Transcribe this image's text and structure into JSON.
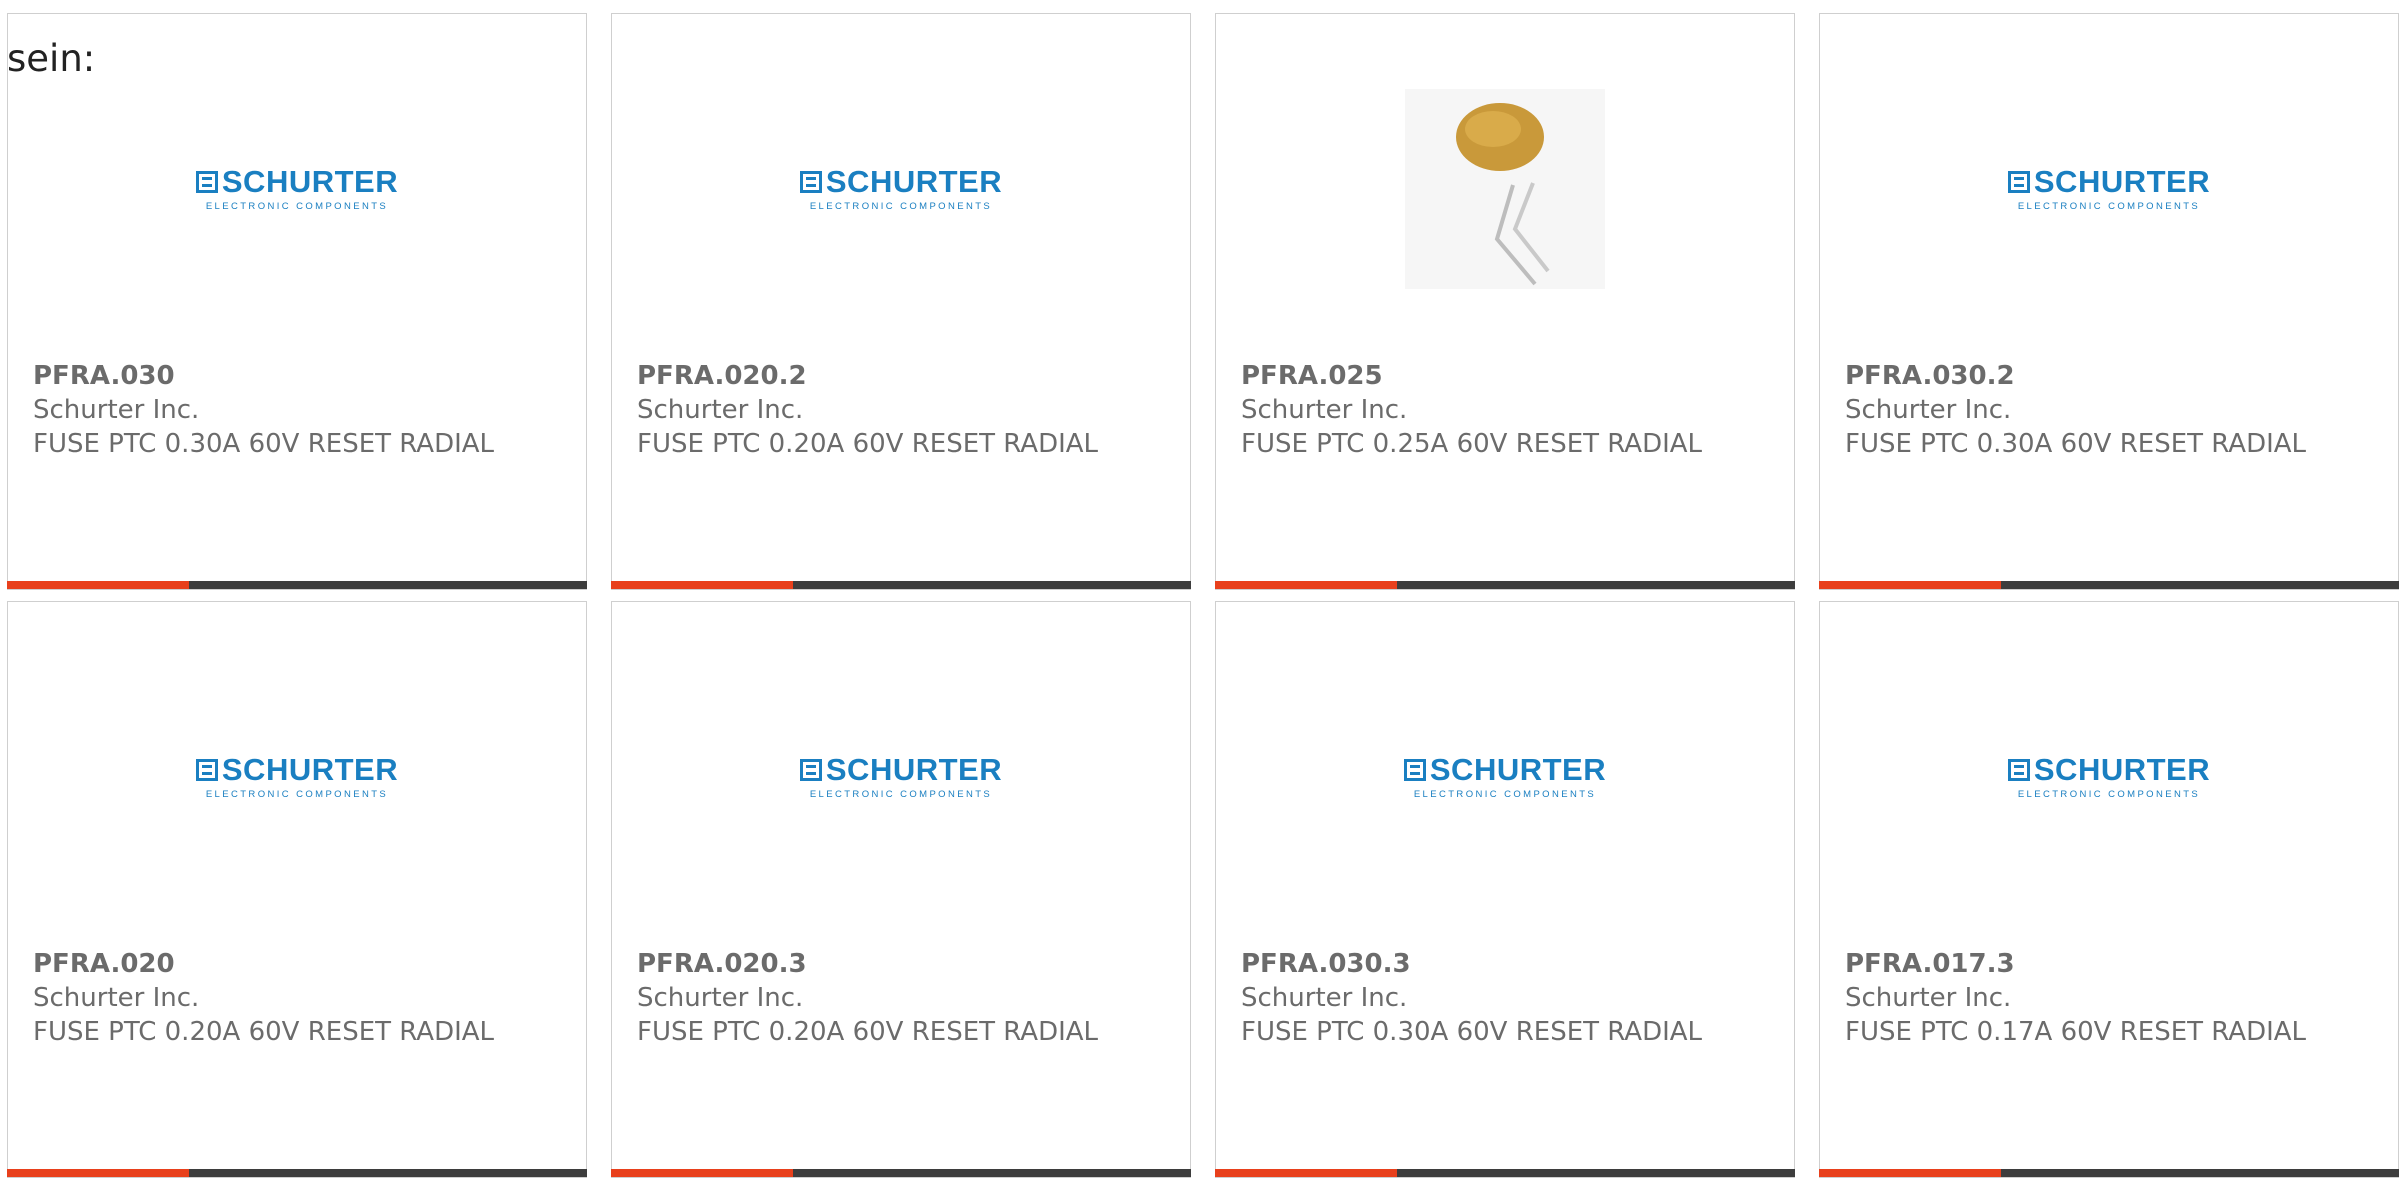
{
  "intro_text": "sein:",
  "colors": {
    "accent": "#e8401c",
    "bar": "#3d3d3d",
    "brand": "#1a7fc1",
    "text": "#6b6b6b"
  },
  "products": [
    {
      "part_number": "PFRA.030",
      "manufacturer": "Schurter Inc.",
      "description": "FUSE PTC 0.30A 60V RESET RADIAL",
      "image": "schurter-logo"
    },
    {
      "part_number": "PFRA.020.2",
      "manufacturer": "Schurter Inc.",
      "description": "FUSE PTC 0.20A 60V RESET RADIAL",
      "image": "schurter-logo"
    },
    {
      "part_number": "PFRA.025",
      "manufacturer": "Schurter Inc.",
      "description": "FUSE PTC 0.25A 60V RESET RADIAL",
      "image": "radial-ptc-fuse-photo"
    },
    {
      "part_number": "PFRA.030.2",
      "manufacturer": "Schurter Inc.",
      "description": "FUSE PTC 0.30A 60V RESET RADIAL",
      "image": "schurter-logo"
    },
    {
      "part_number": "PFRA.020",
      "manufacturer": "Schurter Inc.",
      "description": "FUSE PTC 0.20A 60V RESET RADIAL",
      "image": "schurter-logo"
    },
    {
      "part_number": "PFRA.020.3",
      "manufacturer": "Schurter Inc.",
      "description": "FUSE PTC 0.20A 60V RESET RADIAL",
      "image": "schurter-logo"
    },
    {
      "part_number": "PFRA.030.3",
      "manufacturer": "Schurter Inc.",
      "description": "FUSE PTC 0.30A 60V RESET RADIAL",
      "image": "schurter-logo"
    },
    {
      "part_number": "PFRA.017.3",
      "manufacturer": "Schurter Inc.",
      "description": "FUSE PTC 0.17A 60V RESET RADIAL",
      "image": "schurter-logo"
    }
  ],
  "logo": {
    "word": "SCHURTER",
    "tagline": "ELECTRONIC COMPONENTS"
  }
}
